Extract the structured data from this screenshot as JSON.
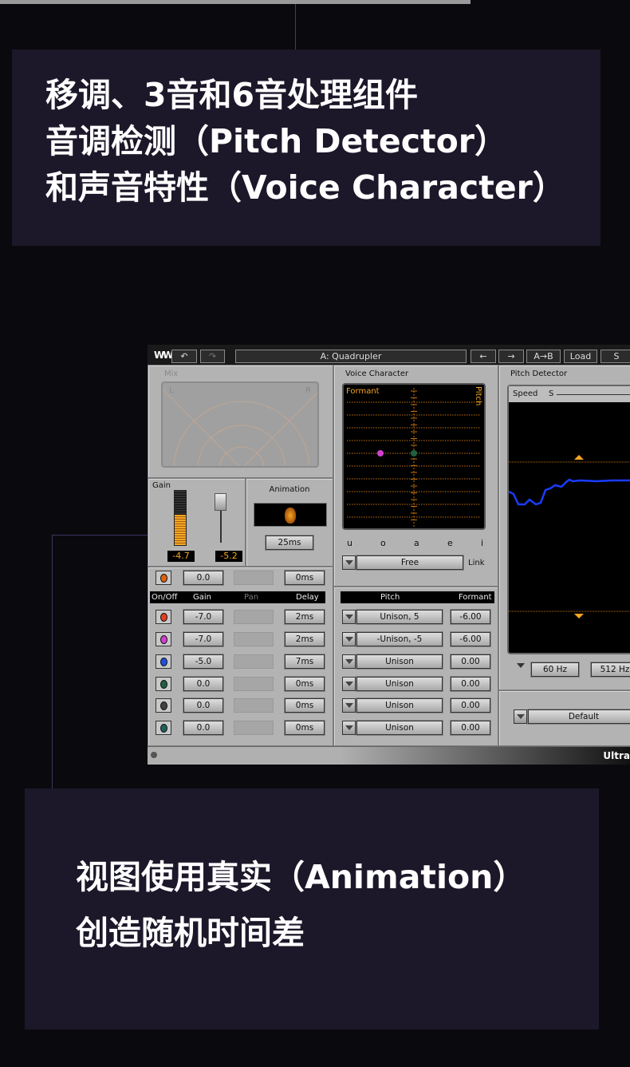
{
  "captions": {
    "top": [
      "移调、3音和6音处理组件",
      "音调检测（Pitch Detector）",
      "和声音特性（Voice Character）"
    ],
    "bottom": [
      "视图使用真实（Animation）",
      "创造随机时间差"
    ]
  },
  "colors": {
    "caption_bg": "#1c1729",
    "accent_orange": "#f5a623",
    "pitch_line": "#1a3cff"
  },
  "toolbar": {
    "logo": "waves-logo",
    "undo": "↶",
    "redo": "↷",
    "preset": "A: Quadrupler",
    "prev": "←",
    "next": "→",
    "ab": "A→B",
    "load": "Load",
    "save": "S"
  },
  "mix": {
    "label": "Mix",
    "left": "L",
    "right": "R"
  },
  "gain": {
    "label": "Gain",
    "meter_value": "-4.7",
    "fader_value": "-5.2"
  },
  "animation": {
    "label": "Animation",
    "value": "25ms"
  },
  "master_row": {
    "gain": "0.0",
    "pan": "",
    "delay": "0ms"
  },
  "columns": {
    "onoff": "On/Off",
    "gain": "Gain",
    "pan": "Pan",
    "delay": "Delay",
    "pitch": "Pitch",
    "formant": "Formant"
  },
  "voices": [
    {
      "color": "#e04020",
      "gain": "-7.0",
      "delay": "2ms",
      "pitch": "Unison, 5",
      "formant": "-6.00"
    },
    {
      "color": "#d040d0",
      "gain": "-7.0",
      "delay": "2ms",
      "pitch": "-Unison, -5",
      "formant": "-6.00"
    },
    {
      "color": "#2050e0",
      "gain": "-5.0",
      "delay": "7ms",
      "pitch": "Unison",
      "formant": "0.00"
    },
    {
      "color": "#206040",
      "gain": "0.0",
      "delay": "0ms",
      "pitch": "Unison",
      "formant": "0.00"
    },
    {
      "color": "#404040",
      "gain": "0.0",
      "delay": "0ms",
      "pitch": "Unison",
      "formant": "0.00"
    },
    {
      "color": "#206060",
      "gain": "0.0",
      "delay": "0ms",
      "pitch": "Unison",
      "formant": "0.00"
    }
  ],
  "voice_character": {
    "label": "Voice Character",
    "formant": "Formant",
    "pitch": "Pitch",
    "vowels": [
      "u",
      "o",
      "a",
      "e",
      "i"
    ],
    "mode": "Free",
    "link": "Link"
  },
  "pitch_detector": {
    "label": "Pitch Detector",
    "speed": "Speed",
    "speed_mark": "S",
    "low": "60 Hz",
    "high": "512 Hz",
    "preset": "Default"
  },
  "footer": {
    "brand": "Ultra"
  }
}
